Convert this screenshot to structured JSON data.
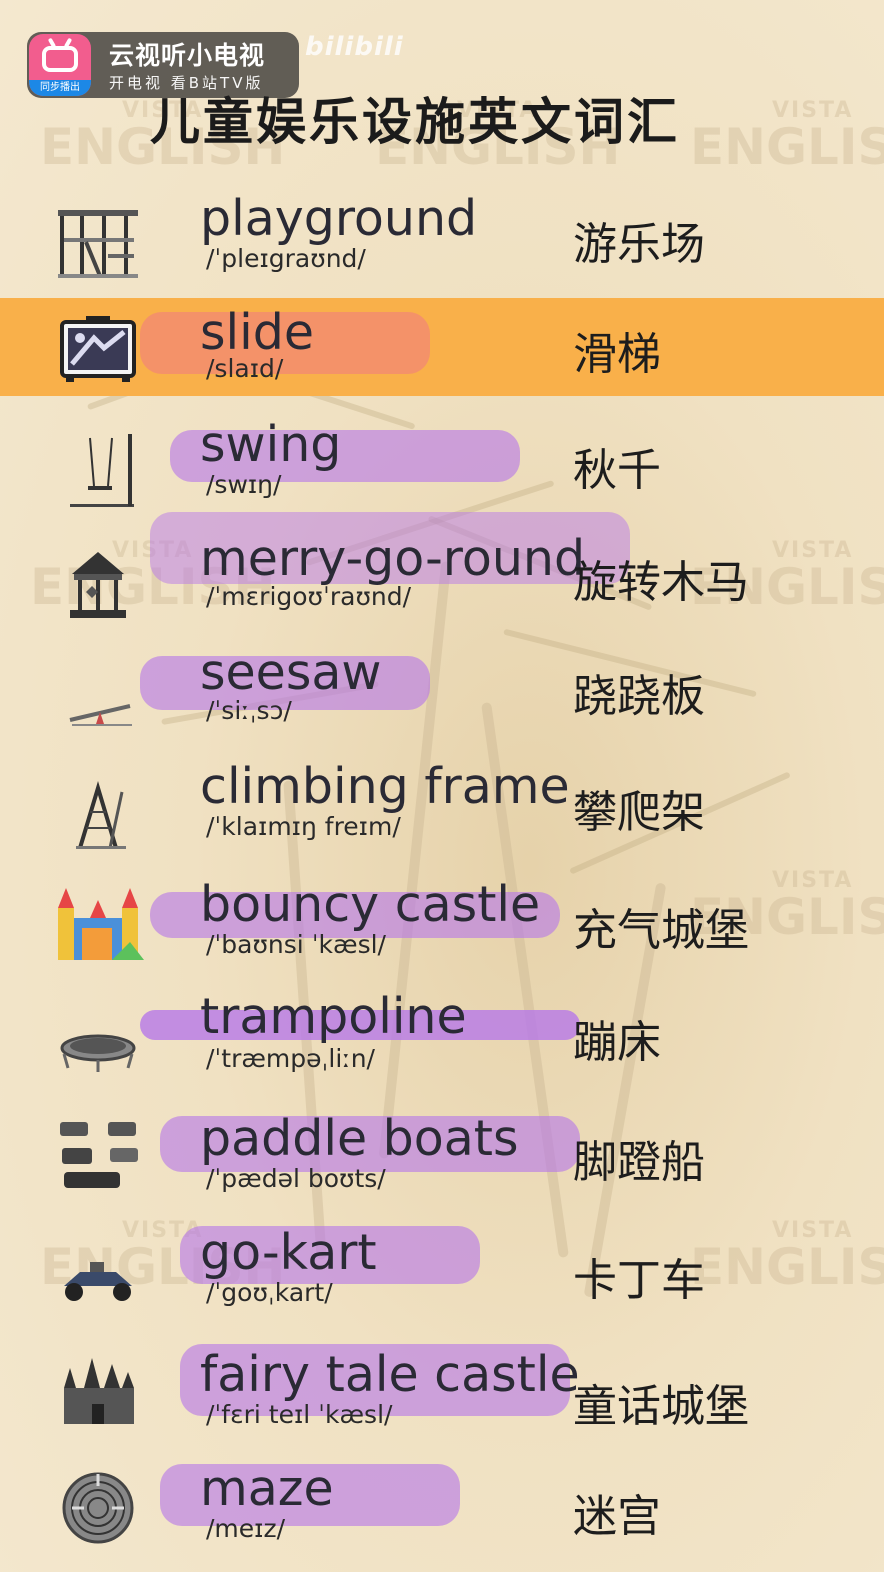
{
  "overlay": {
    "app_name": "云视听小电视",
    "app_subtitle": "开电视 看B站TV版",
    "sync_label": "同步播出",
    "watermark_logo": "bilibili"
  },
  "title": "儿童娱乐设施英文词汇",
  "background_watermark": {
    "small": "VISTA",
    "big": "ENGLISH"
  },
  "vocabulary": [
    {
      "word": "playground",
      "ipa": "/ˈpleɪgraʊnd/",
      "cn": "游乐场",
      "icon": "playground-icon"
    },
    {
      "word": "slide",
      "ipa": "/slaɪd/",
      "cn": "滑梯",
      "icon": "slide-icon",
      "highlighted": true
    },
    {
      "word": "swing",
      "ipa": "/swɪŋ/",
      "cn": "秋千",
      "icon": "swing-icon"
    },
    {
      "word": "merry-go-round",
      "ipa": "/ˈmɛrigoʊˈraʊnd/",
      "cn": "旋转木马",
      "icon": "carousel-icon"
    },
    {
      "word": "seesaw",
      "ipa": "/ˈsiːˌsɔ/",
      "cn": "跷跷板",
      "icon": "seesaw-icon"
    },
    {
      "word": "climbing frame",
      "ipa": "/ˈklaɪmɪŋ freɪm/",
      "cn": "攀爬架",
      "icon": "climbing-frame-icon"
    },
    {
      "word": "bouncy castle",
      "ipa": "/ˈbaʊnsi ˈkæsl/",
      "cn": "充气城堡",
      "icon": "bouncy-castle-icon"
    },
    {
      "word": "trampoline",
      "ipa": "/ˈtræmpəˌliːn/",
      "cn": "蹦床",
      "icon": "trampoline-icon"
    },
    {
      "word": "paddle boats",
      "ipa": "/ˈpædəl boʊts/",
      "cn": "脚蹬船",
      "icon": "paddle-boats-icon"
    },
    {
      "word": "go-kart",
      "ipa": "/ˈgoʊˌkart/",
      "cn": "卡丁车",
      "icon": "go-kart-icon"
    },
    {
      "word": "fairy tale castle",
      "ipa": "/ˈfɛri teɪl ˈkæsl/",
      "cn": "童话城堡",
      "icon": "fairy-tale-castle-icon"
    },
    {
      "word": "maze",
      "ipa": "/meɪz/",
      "cn": "迷宫",
      "icon": "maze-icon"
    }
  ],
  "colors": {
    "highlight": "#f9b04a",
    "marker": "#b778e9",
    "background": "#f3e4c6"
  }
}
